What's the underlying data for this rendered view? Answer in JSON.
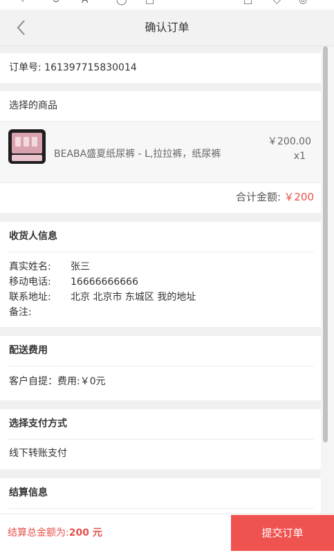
{
  "header": {
    "title": "确认订单"
  },
  "order": {
    "number_text": "订单号: 161397715830014"
  },
  "goods": {
    "heading": "选择的商品",
    "items": [
      {
        "name": "BEABA盛夏纸尿裤 - L,拉拉裤，纸尿裤",
        "price": "￥200.00",
        "qty": "x1"
      }
    ],
    "total_label": "合计金额:",
    "total_value": "￥200"
  },
  "receiver": {
    "heading": "收货人信息",
    "rows": [
      {
        "label": "真实姓名:",
        "value": "张三"
      },
      {
        "label": "移动电话:",
        "value": "16666666666"
      },
      {
        "label": "联系地址:",
        "value": "北京 北京市 东城区 我的地址"
      },
      {
        "label": "备注:",
        "value": ""
      }
    ]
  },
  "shipping": {
    "heading": "配送费用",
    "value": "客户自提：费用:￥0元"
  },
  "payment": {
    "heading": "选择支付方式",
    "value": "线下转账支付"
  },
  "settlement": {
    "heading": "结算信息"
  },
  "footer": {
    "total_label": "结算总金额为:",
    "total_value": "200 元",
    "submit_label": "提交订单"
  },
  "colors": {
    "accent": "#ef5350",
    "price_red": "#e5524a",
    "header_bg": "#f2f2f2",
    "page_bg": "#f0f0f0"
  },
  "icons": {
    "back": "chevron-left-icon"
  }
}
